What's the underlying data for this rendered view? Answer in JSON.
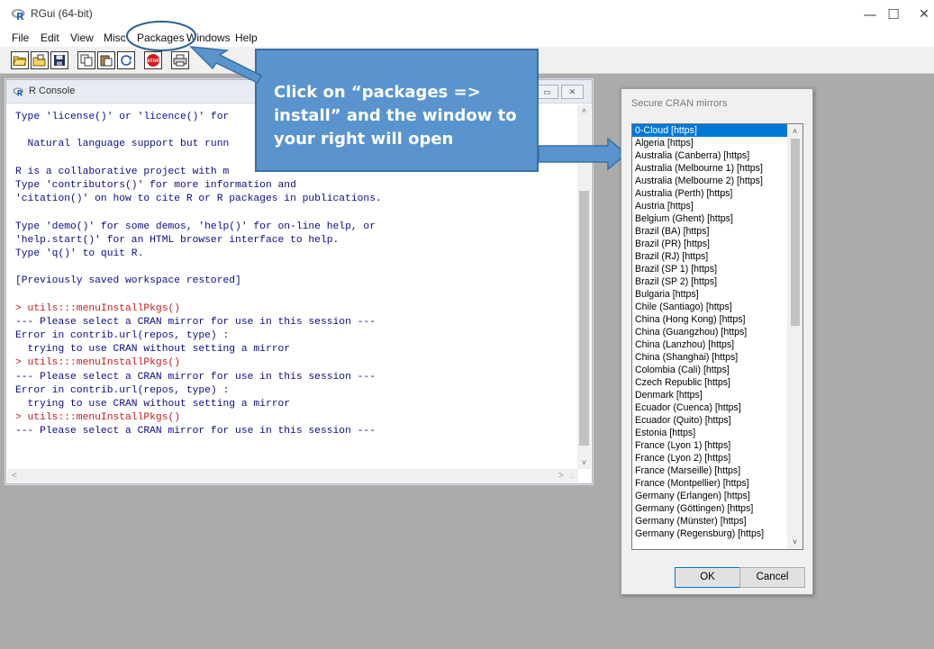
{
  "app": {
    "title": "RGui (64-bit)"
  },
  "window_controls": {
    "minimize": "—",
    "maximize": "☐",
    "close": "✕"
  },
  "menu": [
    "File",
    "Edit",
    "View",
    "Misc",
    "Packages",
    "Windows",
    "Help"
  ],
  "toolbar": {
    "buttons": [
      "open-script-icon",
      "load-workspace-icon",
      "save-workspace-icon",
      "copy-icon",
      "paste-icon",
      "copy-paste-icon",
      "stop-icon",
      "print-icon"
    ],
    "stop_label": "STOP"
  },
  "console": {
    "title": "R Console",
    "window_controls": {
      "restore": "▭",
      "close": "✕"
    },
    "lines": [
      {
        "text": "Type 'license()' or 'licence()' for",
        "kind": "out"
      },
      {
        "text": "",
        "kind": "out"
      },
      {
        "text": "  Natural language support but runn",
        "kind": "out"
      },
      {
        "text": "",
        "kind": "out"
      },
      {
        "text": "R is a collaborative project with m",
        "kind": "out"
      },
      {
        "text": "Type 'contributors()' for more information and",
        "kind": "out"
      },
      {
        "text": "'citation()' on how to cite R or R packages in publications.",
        "kind": "out"
      },
      {
        "text": "",
        "kind": "out"
      },
      {
        "text": "Type 'demo()' for some demos, 'help()' for on-line help, or",
        "kind": "out"
      },
      {
        "text": "'help.start()' for an HTML browser interface to help.",
        "kind": "out"
      },
      {
        "text": "Type 'q()' to quit R.",
        "kind": "out"
      },
      {
        "text": "",
        "kind": "out"
      },
      {
        "text": "[Previously saved workspace restored]",
        "kind": "out"
      },
      {
        "text": "",
        "kind": "out"
      },
      {
        "text": "> utils:::menuInstallPkgs()",
        "kind": "cmd"
      },
      {
        "text": "--- Please select a CRAN mirror for use in this session ---",
        "kind": "out"
      },
      {
        "text": "Error in contrib.url(repos, type) :",
        "kind": "out"
      },
      {
        "text": "  trying to use CRAN without setting a mirror",
        "kind": "out"
      },
      {
        "text": "> utils:::menuInstallPkgs()",
        "kind": "cmd"
      },
      {
        "text": "--- Please select a CRAN mirror for use in this session ---",
        "kind": "out"
      },
      {
        "text": "Error in contrib.url(repos, type) :",
        "kind": "out"
      },
      {
        "text": "  trying to use CRAN without setting a mirror",
        "kind": "out"
      },
      {
        "text": "> utils:::menuInstallPkgs()",
        "kind": "cmd"
      },
      {
        "text": "--- Please select a CRAN mirror for use in this session ---",
        "kind": "out"
      }
    ],
    "scroll_up": "˄",
    "scroll_down": "˅",
    "scroll_left": "<",
    "scroll_right": ">",
    "resize_grip": ".:"
  },
  "callout": {
    "text": "Click on “packages => install” and the window to your right will open"
  },
  "cran_dialog": {
    "title": "Secure CRAN mirrors",
    "selected": "0-Cloud [https]",
    "mirrors": [
      "0-Cloud [https]",
      "Algeria [https]",
      "Australia (Canberra) [https]",
      "Australia (Melbourne 1) [https]",
      "Australia (Melbourne 2) [https]",
      "Australia (Perth) [https]",
      "Austria [https]",
      "Belgium (Ghent) [https]",
      "Brazil (BA) [https]",
      "Brazil (PR) [https]",
      "Brazil (RJ) [https]",
      "Brazil (SP 1) [https]",
      "Brazil (SP 2) [https]",
      "Bulgaria [https]",
      "Chile (Santiago) [https]",
      "China (Hong Kong) [https]",
      "China (Guangzhou) [https]",
      "China (Lanzhou) [https]",
      "China (Shanghai) [https]",
      "Colombia (Cali) [https]",
      "Czech Republic [https]",
      "Denmark [https]",
      "Ecuador (Cuenca) [https]",
      "Ecuador (Quito) [https]",
      "Estonia [https]",
      "France (Lyon 1) [https]",
      "France (Lyon 2) [https]",
      "France (Marseille) [https]",
      "France (Montpellier) [https]",
      "Germany (Erlangen) [https]",
      "Germany (Göttingen) [https]",
      "Germany (Münster) [https]",
      "Germany (Regensburg) [https]"
    ],
    "scroll_up": "˄",
    "scroll_down": "˅",
    "ok_label": "OK",
    "cancel_label": "Cancel"
  },
  "colors": {
    "selection": "#0078d7",
    "callout_fill": "#5a94cf",
    "console_output": "#0c0c8a",
    "console_command": "#c8191b",
    "mdi_background": "#ababab"
  }
}
